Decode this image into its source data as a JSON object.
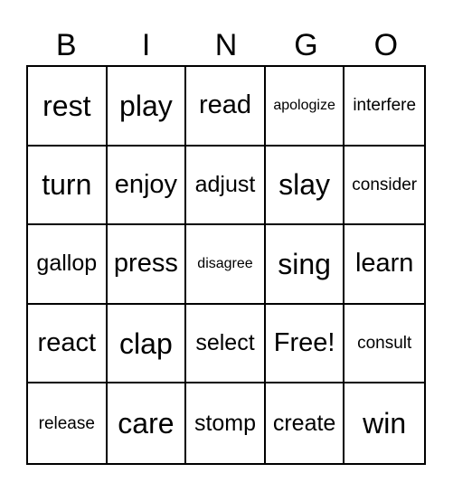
{
  "header": [
    "B",
    "I",
    "N",
    "G",
    "O"
  ],
  "cells": [
    [
      "rest",
      "play",
      "read",
      "apologize",
      "interfere"
    ],
    [
      "turn",
      "enjoy",
      "adjust",
      "slay",
      "consider"
    ],
    [
      "gallop",
      "press",
      "disagree",
      "sing",
      "learn"
    ],
    [
      "react",
      "clap",
      "select",
      "Free!",
      "consult"
    ],
    [
      "release",
      "care",
      "stomp",
      "create",
      "win"
    ]
  ],
  "free_space": {
    "row": 3,
    "col": 3,
    "label": "Free!"
  }
}
